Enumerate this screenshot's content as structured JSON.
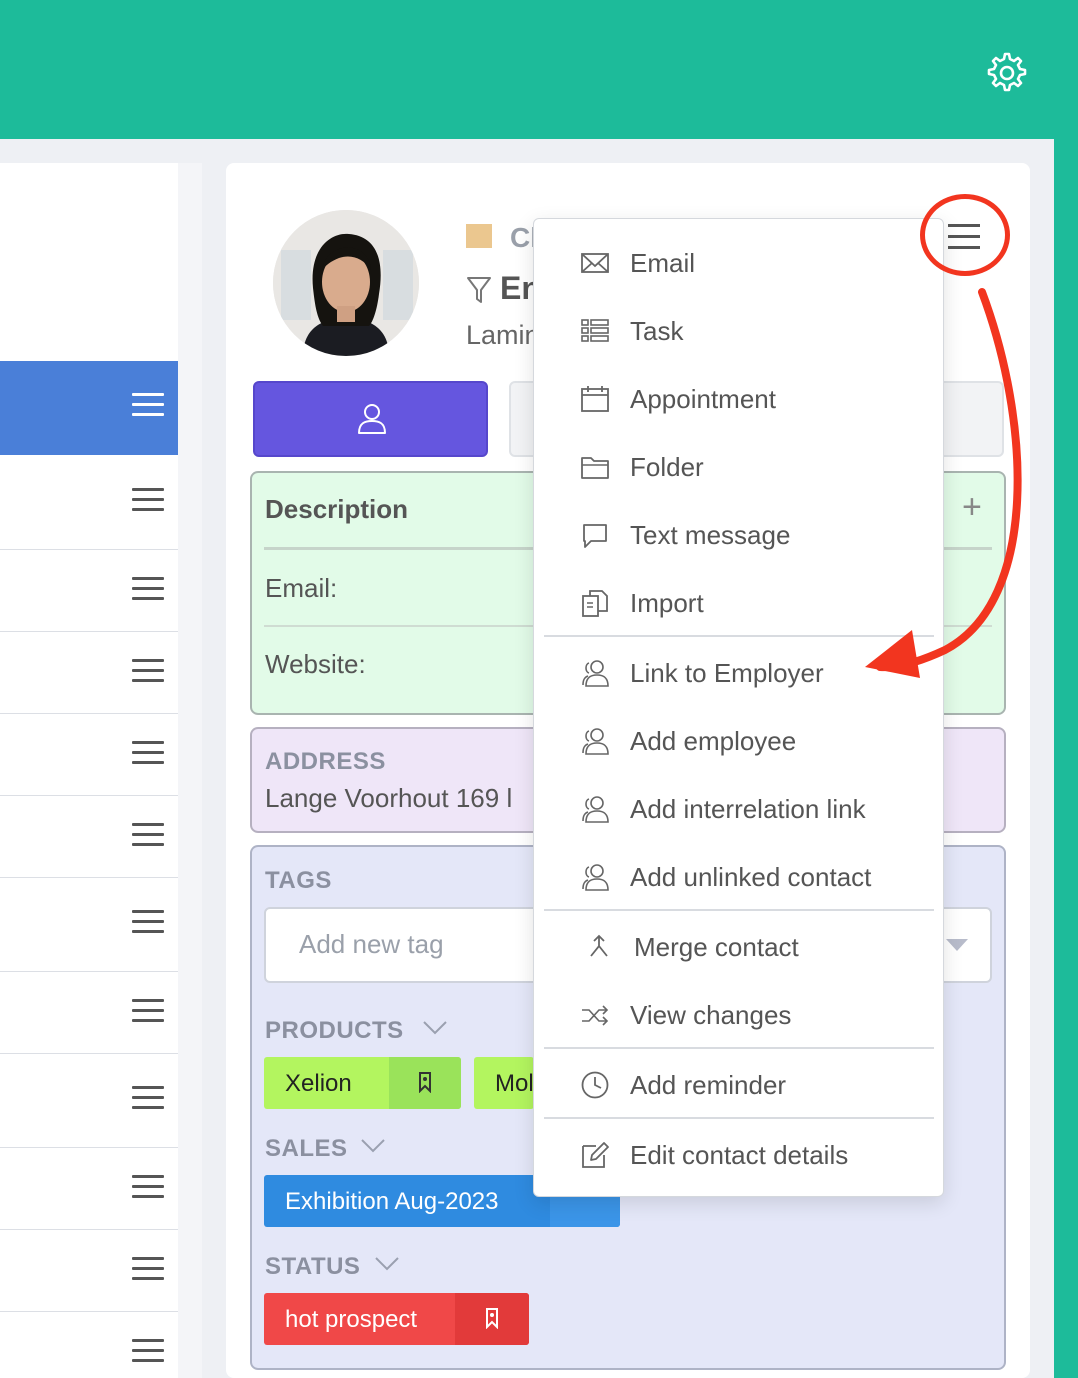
{
  "header": {
    "settings_icon": "gear-icon"
  },
  "contact": {
    "category_initial": "Cl",
    "name_partial": "En",
    "company_partial": "Lamin",
    "filter_icon": "filter-icon"
  },
  "description": {
    "title": "Description",
    "add_symbol": "+",
    "email_label": "Email:",
    "website_label": "Website:"
  },
  "address": {
    "caption": "ADDRESS",
    "value": "Lange Voorhout 169 l"
  },
  "tags": {
    "caption": "TAGS",
    "placeholder": "Add new tag",
    "products_caption": "PRODUCTS",
    "products": [
      "Xelion",
      "Mol"
    ],
    "sales_caption": "SALES",
    "sales": [
      "Exhibition Aug-2023"
    ],
    "status_caption": "STATUS",
    "status": [
      "hot prospect"
    ]
  },
  "menu": {
    "items": [
      {
        "label": "Email",
        "icon": "envelope-icon"
      },
      {
        "label": "Task",
        "icon": "task-list-icon"
      },
      {
        "label": "Appointment",
        "icon": "calendar-icon"
      },
      {
        "label": "Folder",
        "icon": "folder-icon"
      },
      {
        "label": "Text message",
        "icon": "speech-bubble-icon"
      },
      {
        "label": "Import",
        "icon": "import-icon"
      },
      {
        "label": "Link to Employer",
        "icon": "users-icon"
      },
      {
        "label": "Add employee",
        "icon": "users-icon"
      },
      {
        "label": "Add interrelation link",
        "icon": "users-icon"
      },
      {
        "label": "Add unlinked contact",
        "icon": "users-icon"
      },
      {
        "label": "Merge contact",
        "icon": "merge-icon"
      },
      {
        "label": "View changes",
        "icon": "shuffle-icon"
      },
      {
        "label": "Add reminder",
        "icon": "clock-icon"
      },
      {
        "label": "Edit contact details",
        "icon": "edit-icon"
      }
    ]
  },
  "colors": {
    "brand": "#1dbb9a",
    "primary_button": "#6556df",
    "annotation": "#f2351f",
    "product_pill": "#b3f55f",
    "sales_pill": "#2f8be0",
    "status_pill": "#f04848"
  }
}
